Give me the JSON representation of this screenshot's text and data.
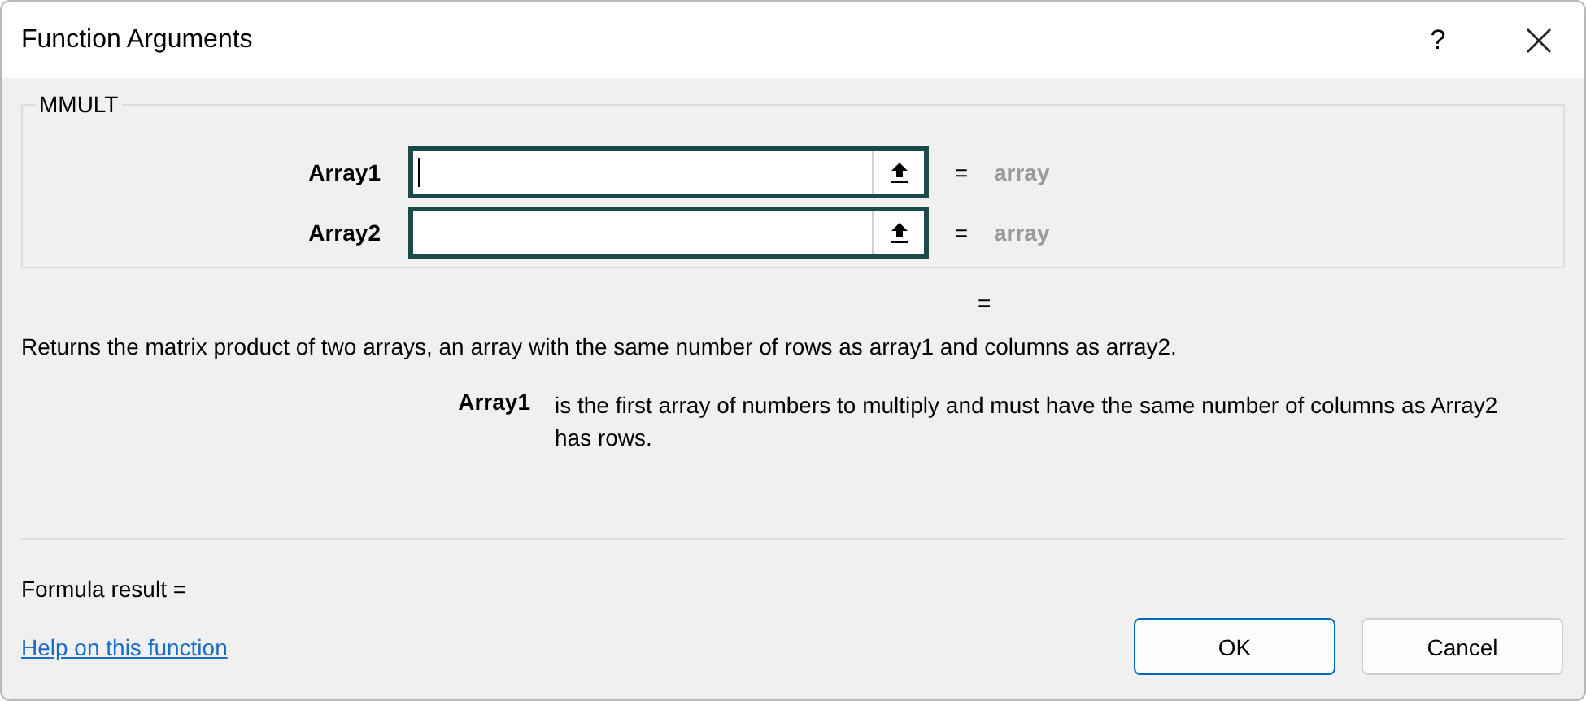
{
  "window": {
    "title": "Function Arguments",
    "help_button": "?"
  },
  "group": {
    "title": "MMULT",
    "arguments": [
      {
        "label": "Array1",
        "equals": "=",
        "result": "array",
        "focused": true
      },
      {
        "label": "Array2",
        "equals": "=",
        "result": "array",
        "focused": false
      }
    ]
  },
  "overall_equals": "=",
  "description": "Returns the matrix product of two arrays, an array with the same number of rows as array1 and columns as array2.",
  "argument_help": {
    "name": "Array1",
    "text": "is the first array of numbers to multiply and must have the same number of columns as Array2 has rows."
  },
  "formula_result": "Formula result =",
  "help_link": "Help on this function",
  "buttons": [
    {
      "label": "OK",
      "default": true
    },
    {
      "label": "Cancel",
      "default": false
    }
  ]
}
